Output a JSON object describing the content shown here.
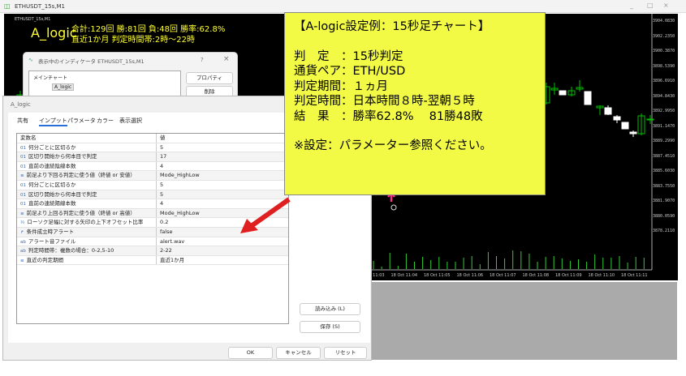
{
  "window": {
    "title": "ETHUSDT_15s,M1",
    "controls": [
      "_",
      "□",
      "×"
    ]
  },
  "chart": {
    "name": "ETHUSDT_15s,M1",
    "indicator_name": "A_logic",
    "stats_line1": "合計:129回 勝:81回 負:48回 勝率:62.8%",
    "stats_line2": "直近1か月 判定時間帯:2時～22時",
    "price_labels": [
      "3904.0830",
      "3902.2350",
      "3900.3870",
      "3898.5390",
      "3896.6910",
      "3894.8430",
      "3892.9950",
      "3891.1470",
      "3889.2990",
      "3887.4510",
      "3885.6030",
      "3883.7550",
      "3881.9070",
      "3880.0590",
      "3878.2110"
    ],
    "time_labels": [
      "18 Oct 11:03",
      "18 Oct 11:04",
      "18 Oct 11:05",
      "18 Oct 11:06",
      "18 Oct 11:07",
      "18 Oct 11:08",
      "18 Oct 11:09",
      "18 Oct 11:10",
      "18 Oct 11:11"
    ],
    "colors": {
      "bull": "#00c000",
      "bear": "#ffffff",
      "signal": "#ff2d8a"
    }
  },
  "indicator_list": {
    "title": "表示中のインディケータ ETHUSDT_15s,M1",
    "help": "?",
    "close": "×",
    "tree_root": "メインチャート",
    "tree_child": "A_logic",
    "properties_button": "プロパティ",
    "delete_button": "削除"
  },
  "properties": {
    "title": "A_logic",
    "tabs": [
      "共有",
      "インプット",
      "パラメータ",
      "カラー",
      "表示選択"
    ],
    "active_tab": 1,
    "headers": [
      "変数名",
      "値"
    ],
    "rows": [
      {
        "icon": "01",
        "name": "何分ごとに区切るか",
        "value": "5"
      },
      {
        "icon": "01",
        "name": "区切り開始から何本目で判定",
        "value": "17"
      },
      {
        "icon": "01",
        "name": "直前の連続陰線本数",
        "value": "4"
      },
      {
        "icon": "≡",
        "name": "前足より下回る判定に使う値（終値 or 安値）",
        "value": "Mode_HighLow"
      },
      {
        "icon": "01",
        "name": "何分ごとに区切るか",
        "value": "5"
      },
      {
        "icon": "01",
        "name": "区切り開始から何本目で判定",
        "value": "5"
      },
      {
        "icon": "01",
        "name": "直前の連続陽線本数",
        "value": "4"
      },
      {
        "icon": "≡",
        "name": "前足より上回る判定に使う値（終値 or 高値）",
        "value": "Mode_HighLow"
      },
      {
        "icon": "½",
        "name": "ローソク足幅に対する矢印の上下オフセット比率",
        "value": "0.2"
      },
      {
        "icon": "↱",
        "name": "条件成立時アラート",
        "value": "false"
      },
      {
        "icon": "ab",
        "name": "アラート音ファイル",
        "value": "alert.wav"
      },
      {
        "icon": "ab",
        "name": "判定時間帯：複数の場合：0-2,5-10",
        "value": "2-22"
      },
      {
        "icon": "≡",
        "name": "直近の判定期間",
        "value": "直近1か月"
      }
    ],
    "load_button": "読み込み (L)",
    "save_button": "保存 (S)",
    "ok_button": "OK",
    "cancel_button": "キャンセル",
    "reset_button": "リセット"
  },
  "callout": {
    "title": "【A-logic設定例：15秒足チャート】",
    "lines": [
      "判　定　：15秒判定",
      "通貨ペア：ETH/USD",
      "判定期間：１ヵ月",
      "判定時間：日本時間８時-翌朝５時",
      "結　果　：勝率62.8%　 81勝48敗"
    ],
    "note": "※設定：パラメーター参照ください。"
  }
}
